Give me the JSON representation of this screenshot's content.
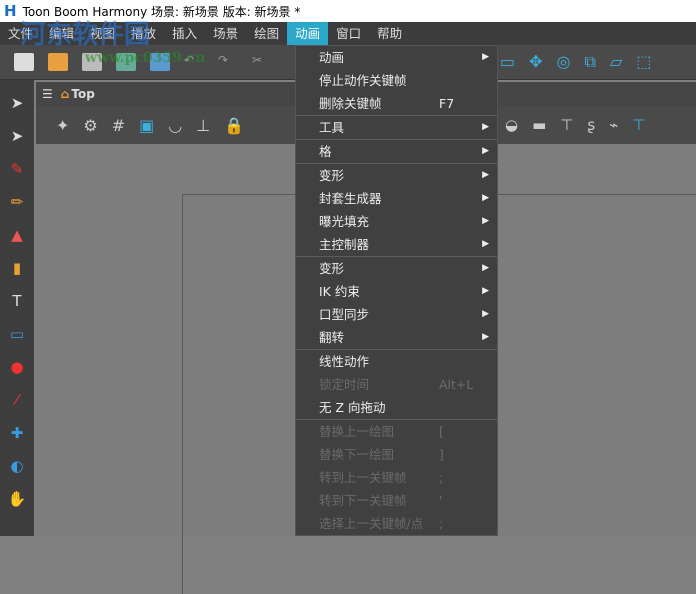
{
  "title": "Toon Boom Harmony 场景: 新场景 版本: 新场景 *",
  "menubar": [
    "文件",
    "编辑",
    "视图",
    "播放",
    "插入",
    "场景",
    "绘图",
    "动画",
    "窗口",
    "帮助"
  ],
  "panel": {
    "breadcrumb": "Top"
  },
  "menu": {
    "groups": [
      [
        {
          "label": "动画",
          "submenu": true
        },
        {
          "label": "停止动作关键帧"
        },
        {
          "label": "删除关键帧",
          "shortcut": "F7"
        }
      ],
      [
        {
          "label": "工具",
          "submenu": true
        }
      ],
      [
        {
          "label": "格",
          "submenu": true
        }
      ],
      [
        {
          "label": "变形",
          "submenu": true
        },
        {
          "label": "封套生成器",
          "submenu": true
        },
        {
          "label": "曝光填充",
          "submenu": true
        },
        {
          "label": "主控制器",
          "submenu": true
        }
      ],
      [
        {
          "label": "变形",
          "submenu": true
        },
        {
          "label": "IK 约束",
          "submenu": true
        },
        {
          "label": "口型同步",
          "submenu": true
        },
        {
          "label": "翻转",
          "submenu": true
        }
      ],
      [
        {
          "label": "线性动作"
        },
        {
          "label": "锁定时间",
          "shortcut": "Alt+L",
          "disabled": true
        },
        {
          "label": "无 Z 向拖动"
        }
      ],
      [
        {
          "label": "替换上一绘图",
          "shortcut": "[",
          "disabled": true
        },
        {
          "label": "替换下一绘图",
          "shortcut": "]",
          "disabled": true
        },
        {
          "label": "转到上一关键帧",
          "shortcut": ";",
          "disabled": true
        },
        {
          "label": "转到下一关键帧",
          "shortcut": "'",
          "disabled": true
        },
        {
          "label": "选择上一关键帧/点",
          "shortcut": ";",
          "disabled": true
        }
      ]
    ]
  },
  "watermark": {
    "name": "河东软件园",
    "url": "www.pc0359.cn"
  },
  "colors": {
    "accent": "#2aa7c9",
    "menu_bg": "#404040"
  }
}
